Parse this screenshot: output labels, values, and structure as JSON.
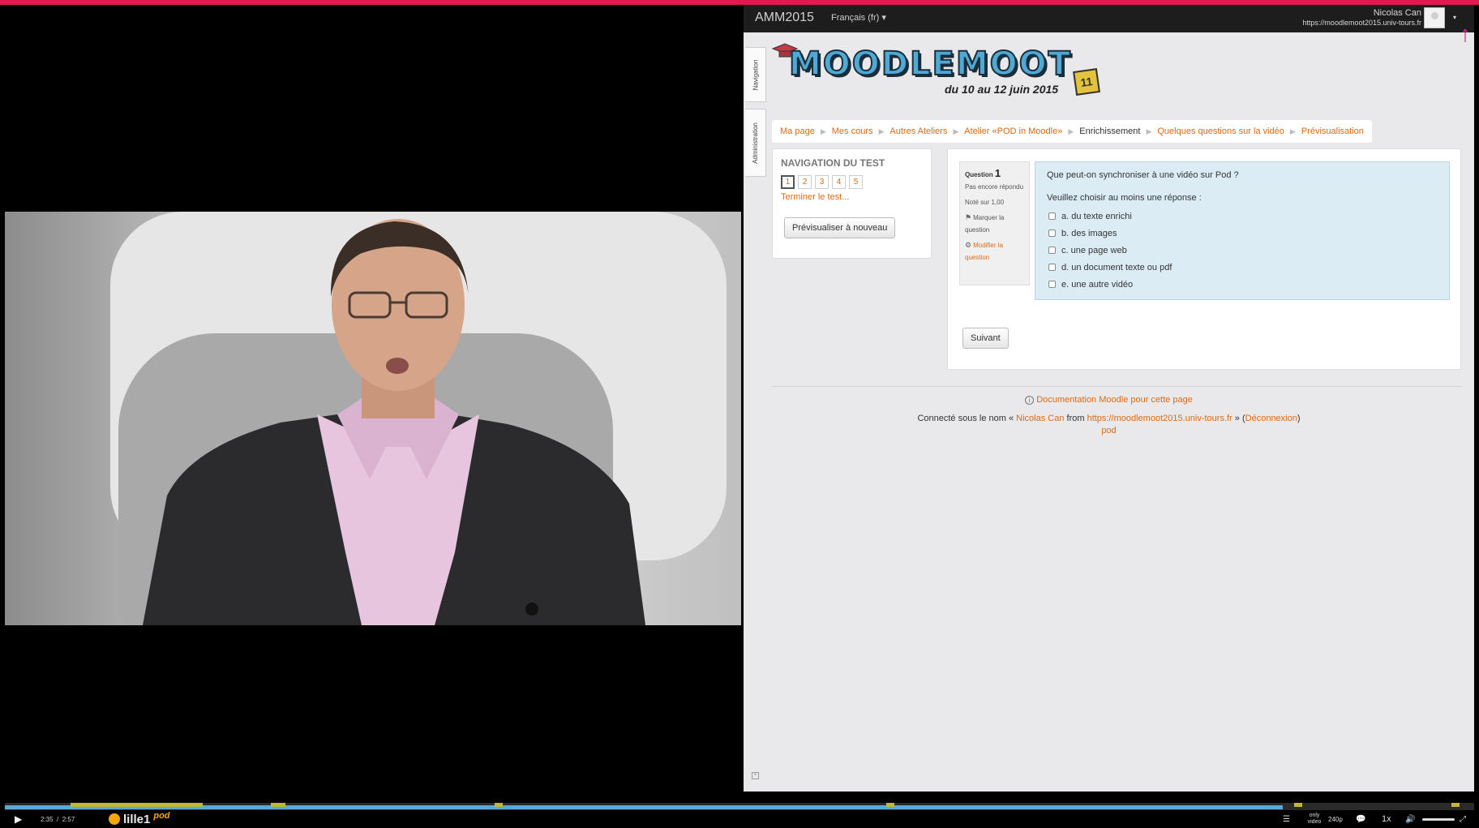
{
  "moodle": {
    "brand": "AMM2015",
    "language": "Français (fr)",
    "user": {
      "name": "Nicolas Can",
      "url": "https://moodlemoot2015.univ-tours.fr"
    },
    "side_tabs": [
      "Navigation",
      "Administration"
    ],
    "logo": {
      "wordmark": "MOODLEMOOT",
      "edition": "11",
      "dates": "du 10 au 12 juin 2015"
    },
    "breadcrumb": [
      "Ma page",
      "Mes cours",
      "Autres Ateliers",
      "Atelier «POD in Moodle»",
      "Enrichissement",
      "Quelques questions sur la vidéo",
      "Prévisualisation"
    ],
    "quiz_nav": {
      "title": "NAVIGATION DU TEST",
      "questions": [
        "1",
        "2",
        "3",
        "4",
        "5"
      ],
      "current": 1,
      "finish": "Terminer le test...",
      "restart": "Prévisualiser à nouveau"
    },
    "question": {
      "label": "Question",
      "number": "1",
      "status": "Pas encore répondu",
      "grade": "Noté sur 1,00",
      "flag": "Marquer la question",
      "edit": "Modifier la question",
      "text": "Que peut-on synchroniser à une vidéo sur Pod ?",
      "prompt": "Veuillez choisir au moins une réponse :",
      "answers": [
        "a. du texte enrichi",
        "b. des images",
        "c. une page web",
        "d. un document texte ou pdf",
        "e. une autre vidéo"
      ]
    },
    "next_button": "Suivant",
    "footer": {
      "doc_link": "Documentation Moodle pour cette page",
      "logged_in_prefix": "Connecté sous le nom « ",
      "user": "Nicolas Can",
      "from": " from ",
      "site": "https://moodlemoot2015.univ-tours.fr",
      "sep": " » (",
      "logout": "Déconnexion",
      "close": ")",
      "pod": "pod"
    }
  },
  "player": {
    "current_time": "2:35",
    "sep": "/",
    "duration": "2:57",
    "progress": 0.87,
    "brand": "lille1",
    "brand_pod": "pod",
    "only_video": "only video",
    "quality": "240p",
    "speed": "1x"
  },
  "colors": {
    "accent": "#e0194f",
    "moodle_link": "#d86a13",
    "timeline_played": "#5aa8d8",
    "chapter_marker": "#c2b63a"
  }
}
